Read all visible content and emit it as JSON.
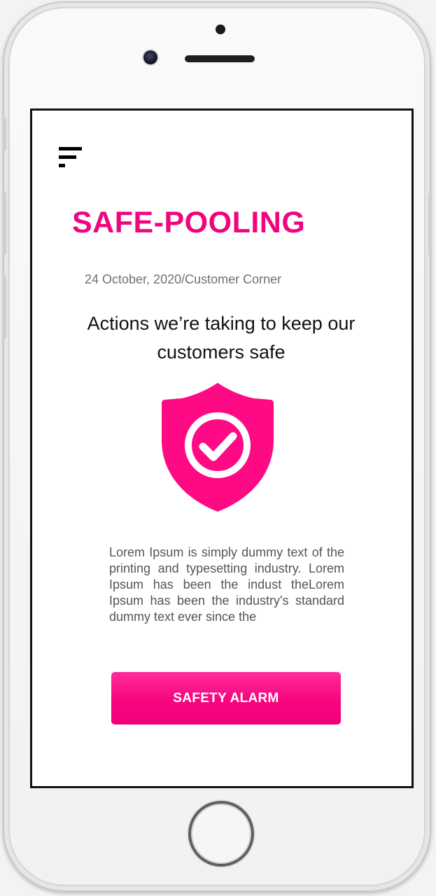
{
  "app": {
    "title": "SAFE-POOLING",
    "meta": "24 October, 2020/Customer Corner"
  },
  "article": {
    "headline": "Actions we’re taking to keep our customers safe",
    "body": "Lorem Ipsum is simply dummy text of the printing and typesetting industry. Lorem Ipsum has been the indust theLorem Ipsum has been the industry's standard dummy text ever since the"
  },
  "actions": {
    "alarm_label": "SAFETY ALARM"
  },
  "icons": {
    "menu": "menu-icon",
    "shield": "shield-check-icon"
  },
  "colors": {
    "accent": "#f0057e",
    "button": "#f6057f",
    "text_dark": "#111111",
    "text_muted": "#707070"
  }
}
